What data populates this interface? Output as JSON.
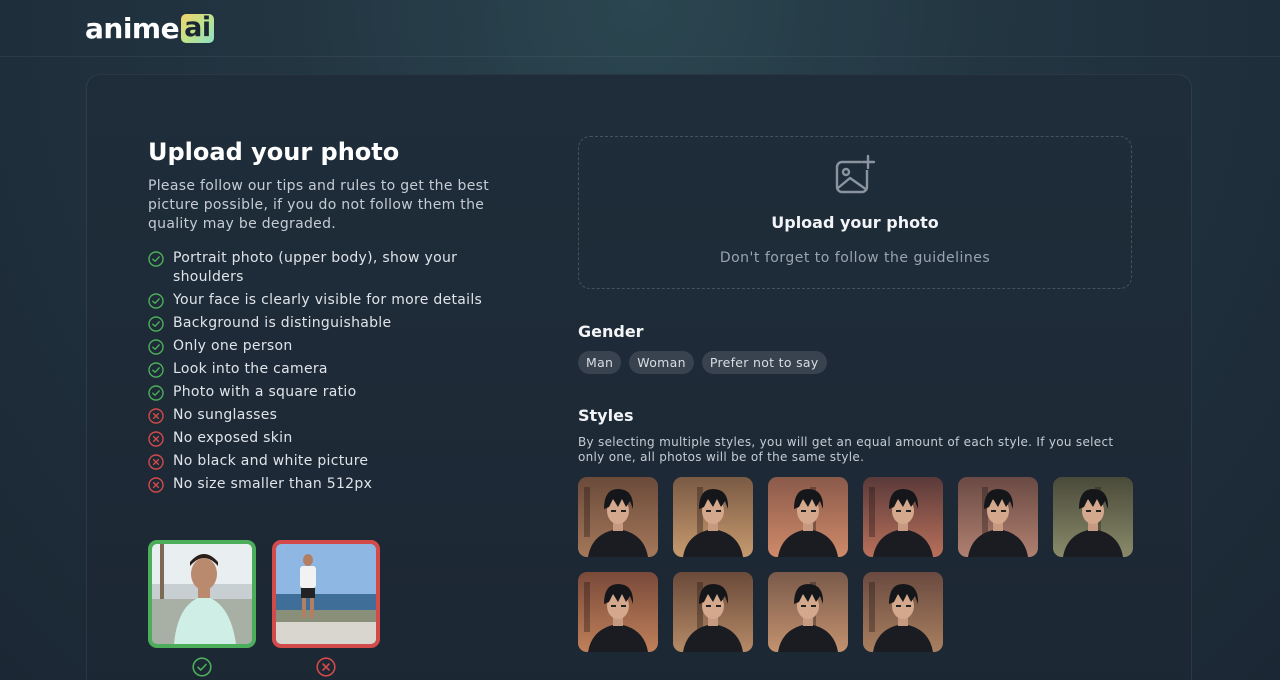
{
  "brand": {
    "name": "anime",
    "badge": "ai"
  },
  "guidelines": {
    "title": "Upload your photo",
    "description": "Please follow our tips and rules to get the best picture possible, if you do not follow them the quality may be degraded.",
    "rules": [
      {
        "text": "Portrait photo (upper body), show your shoulders",
        "ok": true
      },
      {
        "text": "Your face is clearly visible for more details",
        "ok": true
      },
      {
        "text": "Background is distinguishable",
        "ok": true
      },
      {
        "text": "Only one person",
        "ok": true
      },
      {
        "text": "Look into the camera",
        "ok": true
      },
      {
        "text": "Photo with a square ratio",
        "ok": true
      },
      {
        "text": "No sunglasses",
        "ok": false
      },
      {
        "text": "No exposed skin",
        "ok": false
      },
      {
        "text": "No black and white picture",
        "ok": false
      },
      {
        "text": "No size smaller than 512px",
        "ok": false
      }
    ]
  },
  "upload": {
    "title": "Upload your photo",
    "subtitle": "Don't forget to follow the guidelines"
  },
  "gender": {
    "title": "Gender",
    "options": [
      "Man",
      "Woman",
      "Prefer not to say"
    ]
  },
  "styles": {
    "title": "Styles",
    "description": "By selecting multiple styles, you will get an equal amount of each style. If you select only one, all photos will be of the same style."
  },
  "colors": {
    "accent_ok": "#4cae5a",
    "accent_bad": "#d24a4a",
    "chip_bg": "#39434f"
  }
}
